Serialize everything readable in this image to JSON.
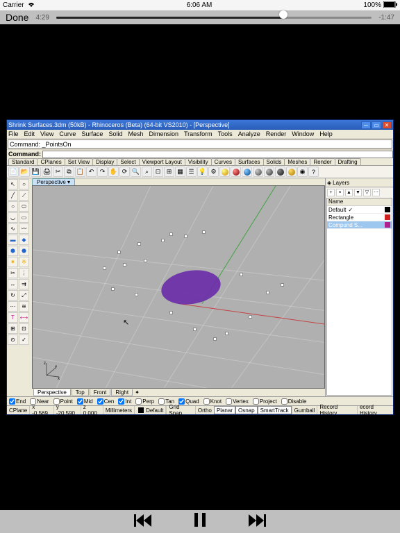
{
  "status": {
    "carrier": "Carrier",
    "time": "6:06 AM",
    "battery": "100%"
  },
  "player": {
    "done": "Done",
    "elapsed": "4:29",
    "remaining": "-1:47"
  },
  "window": {
    "title": "Shrink Surfaces.3dm (50kB) - Rhinoceros (Beta) (64-bit VS2010) - [Perspective]",
    "menus": [
      "File",
      "Edit",
      "View",
      "Curve",
      "Surface",
      "Solid",
      "Mesh",
      "Dimension",
      "Transform",
      "Tools",
      "Analyze",
      "Render",
      "Window",
      "Help"
    ],
    "command_history": "Command: _PointsOn",
    "command_label": "Command:",
    "tool_tabs": [
      "Standard",
      "CPlanes",
      "Set View",
      "Display",
      "Select",
      "Viewport Layout",
      "Visibility",
      "Curves",
      "Surfaces",
      "Solids",
      "Meshes",
      "Render",
      "Drafting"
    ],
    "viewport_top_tab": "Perspective ▾",
    "viewport_bottom_tabs": [
      "Perspective",
      "Top",
      "Front",
      "Right"
    ]
  },
  "layers": {
    "title": "Layers",
    "header": "Name",
    "rows": [
      {
        "name": "Default",
        "color": "#000000"
      },
      {
        "name": "Rectangle",
        "color": "#d02020"
      },
      {
        "name": "Compund S...",
        "color": "#b02090"
      }
    ]
  },
  "osnap": {
    "items": [
      {
        "label": "End",
        "checked": true
      },
      {
        "label": "Near",
        "checked": false
      },
      {
        "label": "Point",
        "checked": false
      },
      {
        "label": "Mid",
        "checked": true
      },
      {
        "label": "Cen",
        "checked": true
      },
      {
        "label": "Int",
        "checked": true
      },
      {
        "label": "Perp",
        "checked": false
      },
      {
        "label": "Tan",
        "checked": false
      },
      {
        "label": "Quad",
        "checked": true
      },
      {
        "label": "Knot",
        "checked": false
      },
      {
        "label": "Vertex",
        "checked": false
      },
      {
        "label": "Project",
        "checked": false
      },
      {
        "label": "Disable",
        "checked": false
      }
    ]
  },
  "statusbar": {
    "cplane": "CPlane",
    "x": "x -0.569",
    "y": "y -20.590",
    "z": "z 0.000",
    "units": "Millimeters",
    "layer": "Default",
    "buttons": [
      "Grid Snap",
      "Ortho",
      "Planar",
      "Osnap",
      "SmartTrack",
      "Gumball",
      "Record History",
      "ecord History"
    ]
  }
}
